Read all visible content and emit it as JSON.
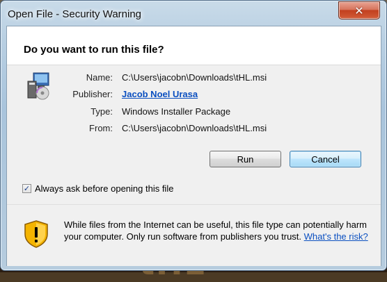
{
  "window": {
    "title": "Open File - Security Warning",
    "close_glyph": "✕"
  },
  "dialog": {
    "question": "Do you want to run this file?",
    "fields": {
      "name_label": "Name:",
      "name_value": "C:\\Users\\jacobn\\Downloads\\tHL.msi",
      "publisher_label": "Publisher:",
      "publisher_value": "Jacob Noel Urasa",
      "type_label": "Type:",
      "type_value": "Windows Installer Package",
      "from_label": "From:",
      "from_value": "C:\\Users\\jacobn\\Downloads\\tHL.msi"
    },
    "buttons": {
      "run_label": "Run",
      "cancel_label": "Cancel"
    },
    "checkbox": {
      "label": "Always ask before opening this file",
      "checked": true
    },
    "warning": {
      "text": "While files from the Internet can be useful, this file type can potentially harm your computer. Only run software from publishers you trust.",
      "link": "What's the risk?"
    }
  },
  "icons": {
    "file": "installer-package-icon",
    "warning": "security-shield-icon"
  },
  "colors": {
    "link": "#0a4fc0",
    "close_button": "#c2401f",
    "shield_yellow": "#f4b400"
  }
}
